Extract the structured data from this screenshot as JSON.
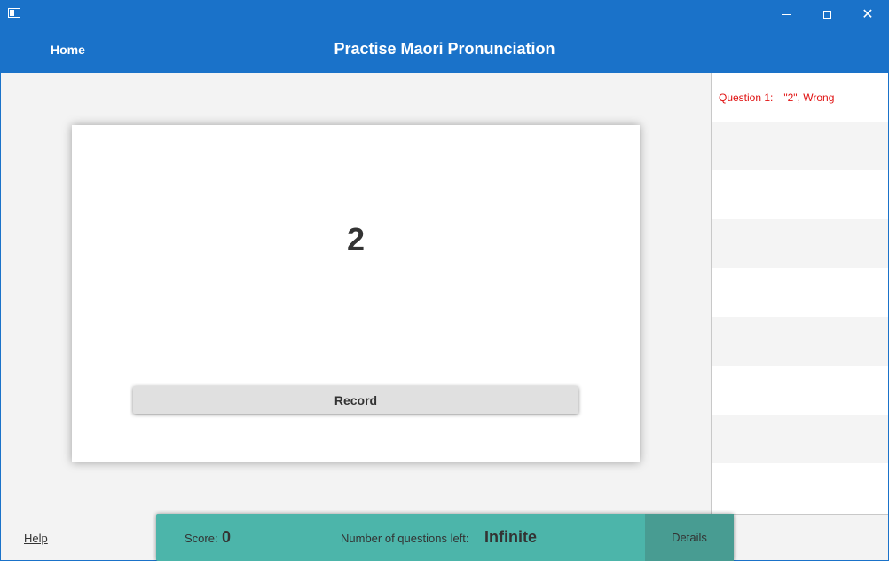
{
  "window": {
    "icon": "app-window-icon",
    "controls": {
      "minimize_icon": "minimize-icon",
      "maximize_icon": "maximize-icon",
      "close_glyph": "✕"
    }
  },
  "header": {
    "home_label": "Home",
    "title": "Practise Maori Pronunciation",
    "background_color": "#1a72c9"
  },
  "card": {
    "question_word": "2",
    "record_label": "Record"
  },
  "results": {
    "items": [
      {
        "question_label": "Question 1:",
        "answer": "\"2\"",
        "verdict": "Wrong",
        "color": "#e01010"
      }
    ]
  },
  "footer": {
    "help_label": "Help",
    "score_label": "Score:",
    "score_value": "0",
    "questions_left_label": "Number of questions left:",
    "questions_left_value": "Infinite",
    "details_label": "Details",
    "status_bar_color": "#4cb5aa"
  }
}
